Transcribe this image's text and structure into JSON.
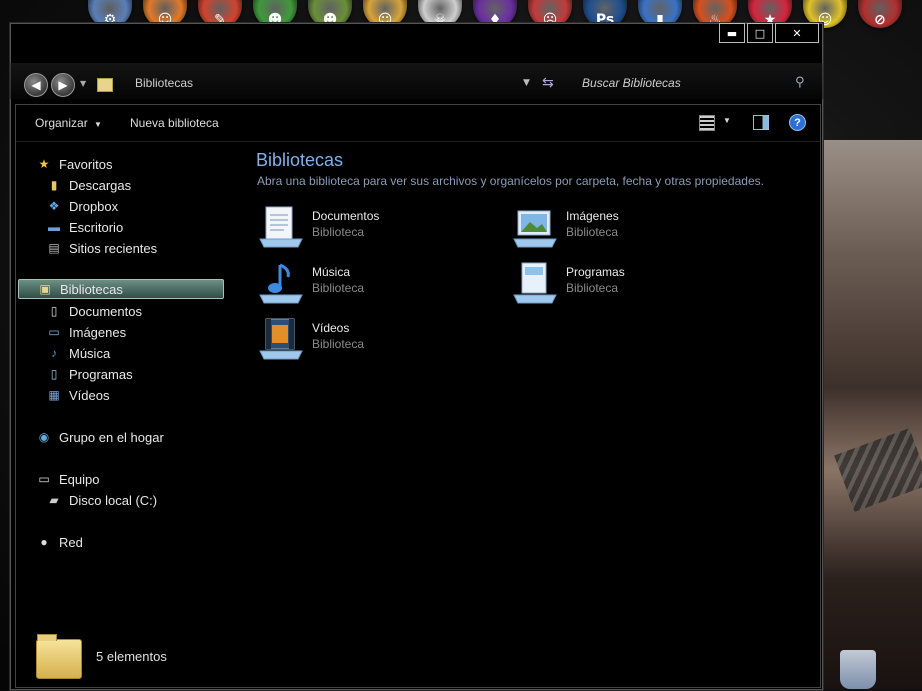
{
  "dock": {
    "icons": [
      {
        "name": "gears-app-icon",
        "color": "#5b7fb8",
        "glyph": "⚙"
      },
      {
        "name": "fox-app-icon",
        "color": "#e07a2a",
        "glyph": "☺"
      },
      {
        "name": "chart-app-icon",
        "color": "#d0442f",
        "glyph": "✎"
      },
      {
        "name": "frog-app-icon",
        "color": "#3f9a3a",
        "glyph": "☻"
      },
      {
        "name": "character-app-icon",
        "color": "#6a8f3a",
        "glyph": "☻"
      },
      {
        "name": "girl-app-icon",
        "color": "#d7a43a",
        "glyph": "☺"
      },
      {
        "name": "ghost-app-icon",
        "color": "#cfcfcf",
        "glyph": "☠"
      },
      {
        "name": "purple-app-icon",
        "color": "#6a2fa0",
        "glyph": "♦"
      },
      {
        "name": "face-app-icon",
        "color": "#c23b3b",
        "glyph": "☹"
      },
      {
        "name": "photoshop-icon",
        "color": "#1f4f8f",
        "glyph": "Ps"
      },
      {
        "name": "folder-app-icon",
        "color": "#3a72c6",
        "glyph": "▮"
      },
      {
        "name": "fire-app-icon",
        "color": "#d6501e",
        "glyph": "♨"
      },
      {
        "name": "gift-app-icon",
        "color": "#d4263f",
        "glyph": "★"
      },
      {
        "name": "smiley-app-icon",
        "color": "#e0c22a",
        "glyph": "☺"
      },
      {
        "name": "blocked-app-icon",
        "color": "#b23030",
        "glyph": "⊘"
      }
    ]
  },
  "window": {
    "buttons": {
      "minimize": "▬",
      "maximize": "□",
      "close": "✕"
    }
  },
  "address": {
    "path": "Bibliotecas",
    "search_placeholder": "Buscar Bibliotecas"
  },
  "toolbar": {
    "organize": "Organizar",
    "new_library": "Nueva biblioteca",
    "help": "?"
  },
  "sidebar": {
    "favorites": {
      "label": "Favoritos",
      "items": [
        "Descargas",
        "Dropbox",
        "Escritorio",
        "Sitios recientes"
      ]
    },
    "libraries": {
      "label": "Bibliotecas",
      "items": [
        "Documentos",
        "Imágenes",
        "Música",
        "Programas",
        "Vídeos"
      ]
    },
    "homegroup": "Grupo en el hogar",
    "computer": {
      "label": "Equipo",
      "items": [
        "Disco local (C:)"
      ]
    },
    "network": "Red"
  },
  "main": {
    "title": "Bibliotecas",
    "description": "Abra una biblioteca para ver sus archivos y organícelos por carpeta, fecha y otras propiedades.",
    "libraries": [
      {
        "name": "Documentos",
        "kind": "Biblioteca"
      },
      {
        "name": "Imágenes",
        "kind": "Biblioteca"
      },
      {
        "name": "Música",
        "kind": "Biblioteca"
      },
      {
        "name": "Programas",
        "kind": "Biblioteca"
      },
      {
        "name": "Vídeos",
        "kind": "Biblioteca"
      }
    ]
  },
  "status": {
    "count_text": "5 elementos"
  },
  "colors": {
    "selected_bg": "#3f6258",
    "title_blue": "#7fb1e8"
  }
}
